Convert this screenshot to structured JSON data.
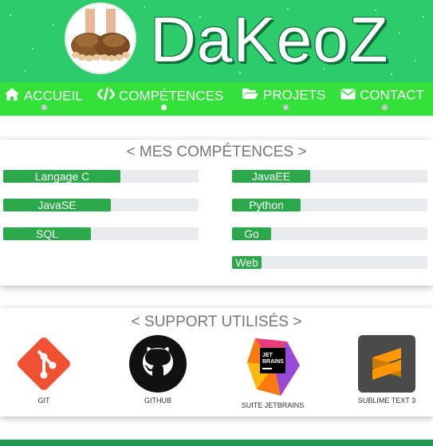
{
  "header": {
    "title": "DaKeoZ",
    "brand_color": "#2ccc6c"
  },
  "nav": {
    "items": [
      {
        "label": "ACCUEIL",
        "icon": "home-icon",
        "active": false
      },
      {
        "label": "COMPÉTENCES",
        "icon": "code-icon",
        "active": true
      },
      {
        "label": "PROJETS",
        "icon": "folder-open-icon",
        "active": false
      },
      {
        "label": "CONTACT",
        "icon": "envelope-icon",
        "active": false
      }
    ],
    "color": "#34e03a"
  },
  "skills": {
    "title": "< MES COMPÉTENCES >",
    "items": [
      {
        "name": "Langage C",
        "level": 0.6
      },
      {
        "name": "JavaEE",
        "level": 0.4
      },
      {
        "name": "JavaSE",
        "level": 0.55
      },
      {
        "name": "Python",
        "level": 0.35
      },
      {
        "name": "SQL",
        "level": 0.45
      },
      {
        "name": "Go",
        "level": 0.2
      },
      {
        "name": "Web",
        "level": 0.15
      }
    ],
    "fill_color": "#2aa84a"
  },
  "supports": {
    "title": "< SUPPORT UTILISÉS >",
    "items": [
      {
        "label": "GIT",
        "icon": "git-logo-icon"
      },
      {
        "label": "GITHUB",
        "icon": "github-logo-icon"
      },
      {
        "label": "SUITE JETBRAINS",
        "icon": "jetbrains-logo-icon"
      },
      {
        "label": "SUBLIME TEXT 3",
        "icon": "sublime-text-logo-icon"
      }
    ]
  }
}
